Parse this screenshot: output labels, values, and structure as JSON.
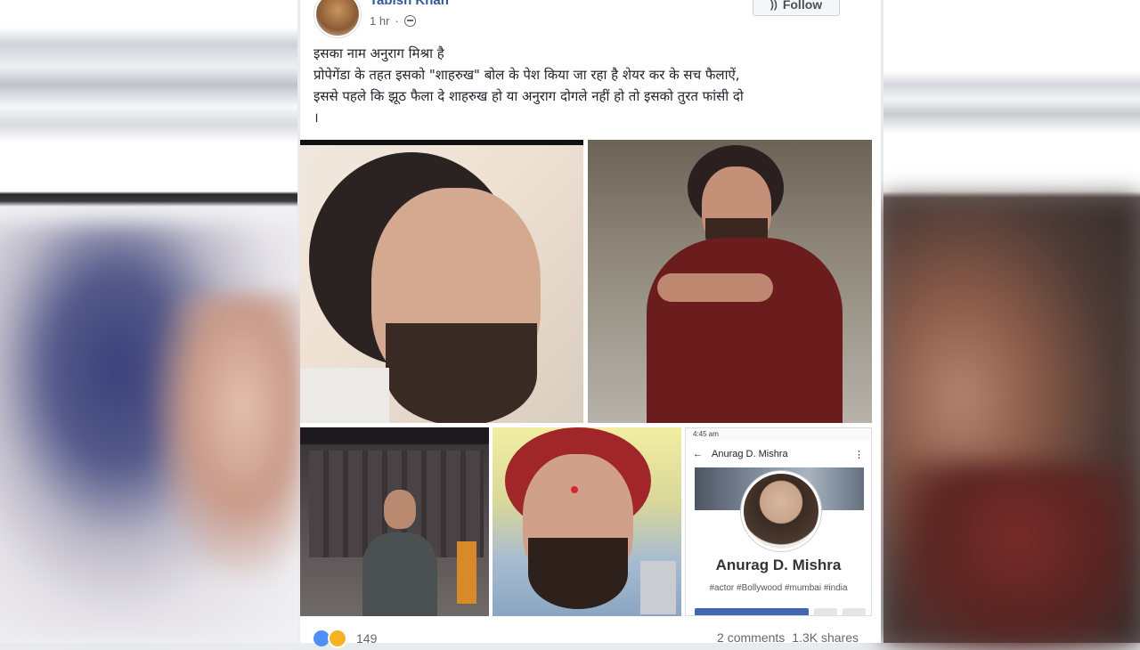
{
  "post": {
    "author": "Tabish Khan",
    "time": "1 hr",
    "follow_label": "Follow",
    "text_lines": [
      "इसका नाम अनुराग मिश्रा है",
      "प्रोपेगेंडा के तहत इसको \"शाहरुख\" बोल के पेश किया जा रहा है शेयर कर के सच फैलाऐं,",
      "इससे पहले कि झूठ फैला दे शाहरुख हो या अनुराग दोगले नहीं हो तो इसको तुरत फांसी दो",
      "।"
    ]
  },
  "profile_screenshot": {
    "status_time": "4:45 am",
    "title": "Anurag D. Mishra",
    "name": "Anurag D. Mishra",
    "tags": "#actor #Bollywood #mumbai #india"
  },
  "footer": {
    "reaction_count": "149",
    "comments": "2 comments",
    "shares": "1.3K shares"
  },
  "icons": {
    "avatar": "author-avatar",
    "audience": "globe-icon",
    "reactions": [
      "like-icon",
      "haha-icon"
    ],
    "follow": "rss-icon"
  },
  "colors": {
    "author_link": "#365899",
    "like": "#4f8ef7",
    "haha": "#f7b125"
  }
}
